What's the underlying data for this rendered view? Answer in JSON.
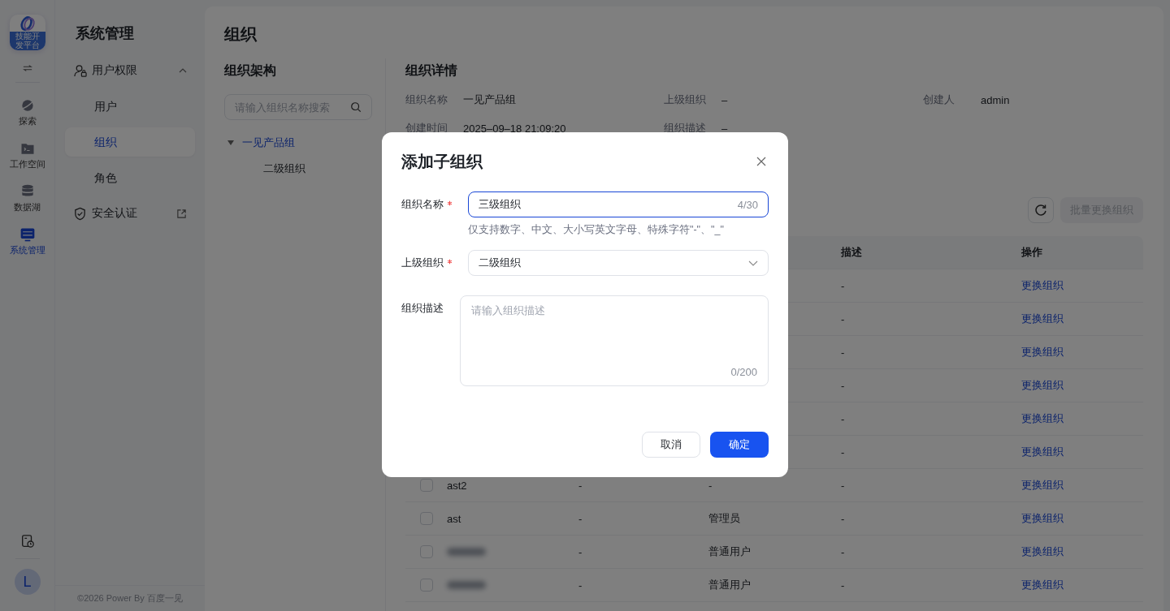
{
  "rail": {
    "logo_text": "技能开发平台",
    "items": [
      {
        "label": "探索",
        "selected": false
      },
      {
        "label": "工作空间",
        "selected": false
      },
      {
        "label": "数据湖",
        "selected": false
      },
      {
        "label": "系统管理",
        "selected": true
      }
    ],
    "avatar": "L"
  },
  "sidebar": {
    "title": "系统管理",
    "items": [
      {
        "kind": "group",
        "label": "用户权限",
        "expanded": true,
        "children": [
          {
            "label": "用户",
            "selected": false
          },
          {
            "label": "组织",
            "selected": true
          },
          {
            "label": "角色",
            "selected": false
          }
        ]
      },
      {
        "kind": "external",
        "label": "安全认证"
      }
    ],
    "footer": "©2026 Power By 百度一见"
  },
  "page": {
    "title": "组织"
  },
  "tree_panel": {
    "title": "组织架构",
    "search": {
      "placeholder": "请输入组织名称搜索"
    },
    "nodes": [
      {
        "label": "一见产品组",
        "expanded": true,
        "selected": true,
        "children": [
          {
            "label": "二级组织",
            "selected": false
          }
        ]
      }
    ]
  },
  "details": {
    "title": "组织详情",
    "fields": [
      {
        "label": "组织名称",
        "value": "一见产品组"
      },
      {
        "label": "上级组织",
        "value": "–"
      },
      {
        "label": "创建人",
        "value": "admin"
      },
      {
        "label": "创建时间",
        "value": "2025–09–18 21:09:20"
      },
      {
        "label": "组织描述",
        "value": "–"
      }
    ]
  },
  "toolbar": {
    "batch_button": {
      "label": "批量更换组织",
      "disabled": true
    }
  },
  "table": {
    "columns": [
      "描述",
      "操作"
    ],
    "rows": [
      {
        "description": "-",
        "action": "更换组织"
      },
      {
        "description": "-",
        "action": "更换组织"
      },
      {
        "description": "-",
        "action": "更换组织"
      },
      {
        "description": "-",
        "action": "更换组织"
      },
      {
        "description": "-",
        "action": "更换组织"
      },
      {
        "description": "-",
        "action": "更换组织"
      },
      {
        "checked": false,
        "blurred": false,
        "name": "ast2",
        "column_2": "-",
        "column_3": "-",
        "description": "-",
        "action": "更换组织"
      },
      {
        "checked": false,
        "blurred": false,
        "name": "ast",
        "column_2": "-",
        "column_3": "管理员",
        "description": "-",
        "action": "更换组织"
      },
      {
        "checked": false,
        "blurred": true,
        "column_2": "-",
        "column_3": "普通用户",
        "description": "-",
        "action": "更换组织"
      },
      {
        "checked": false,
        "blurred": true,
        "column_2": "-",
        "column_3": "普通用户",
        "description": "-",
        "action": "更换组织"
      }
    ]
  },
  "dialog": {
    "title": "添加子组织",
    "fields": [
      {
        "kind": "input",
        "label": "组织名称",
        "required": true,
        "value": "三级组织",
        "counter": "4/30",
        "focused": true,
        "hint": "仅支持数字、中文、大小写英文字母、特殊字符\"-\"、\"_\""
      },
      {
        "kind": "select",
        "label": "上级组织",
        "required": true,
        "value": "二级组织"
      },
      {
        "kind": "textarea",
        "label": "组织描述",
        "required": false,
        "placeholder": "请输入组织描述",
        "counter": "0/200"
      }
    ],
    "buttons": [
      {
        "kind": "secondary",
        "label": "取消"
      },
      {
        "kind": "primary",
        "label": "确定"
      }
    ]
  }
}
